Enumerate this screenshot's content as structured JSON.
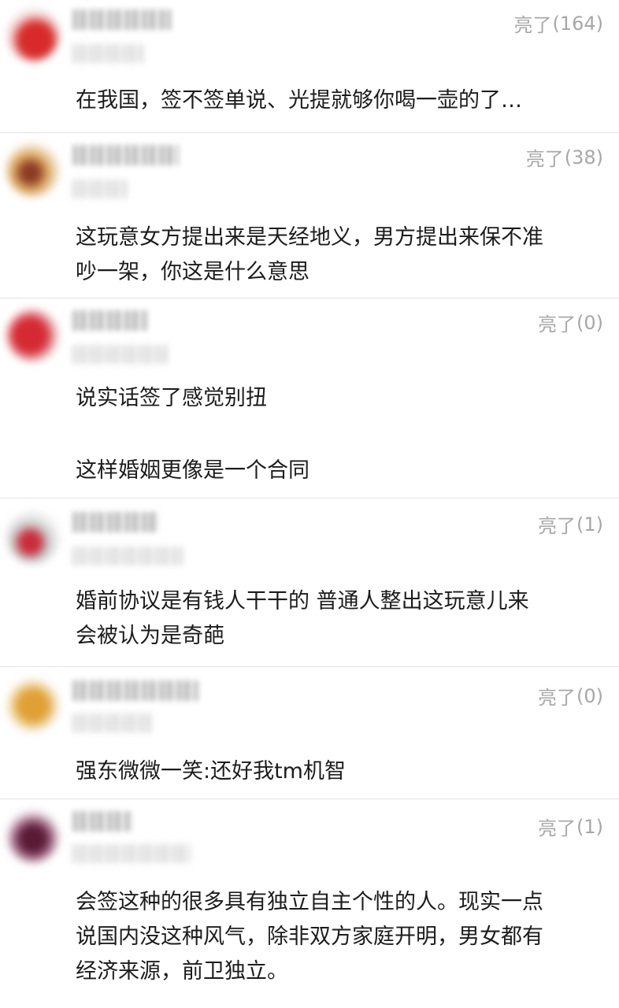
{
  "comments": [
    {
      "likes_label": "亮了",
      "likes_count": "(164)",
      "lines": [
        "在我国，签不签单说、光提就够你喝一壶的了…"
      ]
    },
    {
      "likes_label": "亮了",
      "likes_count": "(38)",
      "lines": [
        "这玩意女方提出来是天经地义，男方提出来保不准",
        "吵一架，你这是什么意思"
      ]
    },
    {
      "likes_label": "亮了",
      "likes_count": "(0)",
      "lines": [
        "说实话签了感觉别扭",
        "这样婚姻更像是一个合同"
      ]
    },
    {
      "likes_label": "亮了",
      "likes_count": "(1)",
      "lines": [
        "婚前协议是有钱人干干的 普通人整出这玩意儿来",
        "会被认为是奇葩"
      ]
    },
    {
      "likes_label": "亮了",
      "likes_count": "(0)",
      "lines": [
        "强东微微一笑:还好我tm机智"
      ]
    },
    {
      "likes_label": "亮了",
      "likes_count": "(1)",
      "lines": [
        "会签这种的很多具有独立自主个性的人。现实一点",
        "说国内没这种风气，除非双方家庭开明，男女都有",
        "经济来源，前卫独立。"
      ]
    }
  ],
  "avatar_colors": [
    "#d82a2a",
    "#b06a3a",
    "#d52a34",
    "#c92c3a",
    "#e0a035",
    "#5a1a36"
  ]
}
